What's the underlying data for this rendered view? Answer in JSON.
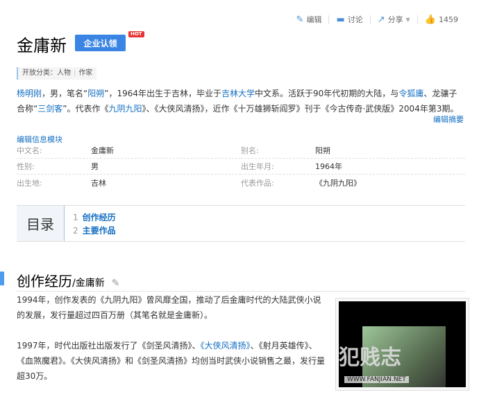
{
  "toolbar": {
    "edit": "编辑",
    "discuss": "讨论",
    "share": "分享",
    "likes": "1459"
  },
  "title": "金庸新",
  "claim_button": "企业认领",
  "hot_badge": "HOT",
  "category": {
    "label": "开放分类：",
    "items": [
      "人物",
      "作家"
    ]
  },
  "summary": {
    "parts": [
      {
        "t": "杨明刚",
        "link": true
      },
      {
        "t": "，男，笔名“"
      },
      {
        "t": "阳朔",
        "link": true
      },
      {
        "t": "”，1964年出生于吉林，毕业于"
      },
      {
        "t": "吉林大学",
        "link": true
      },
      {
        "t": "中文系。活跃于90年代初期的大陆，与"
      },
      {
        "t": "令狐庸",
        "link": true
      },
      {
        "t": "、龙骧子合称“"
      },
      {
        "t": "三剑客",
        "link": true
      },
      {
        "t": "”。代表作《"
      },
      {
        "t": "九阴九阳",
        "link": true
      },
      {
        "t": "》、《大侠风清扬》，近作《十万雄狮斩阎罗》刊于《今古传奇·武侠版》2004年第3期。"
      }
    ],
    "edit_summary": "编辑摘要"
  },
  "info": {
    "edit_label": "编辑信息模块",
    "rows": [
      [
        {
          "label": "中文名:",
          "value": "金庸新"
        },
        {
          "label": "别名:",
          "value": "阳朔"
        }
      ],
      [
        {
          "label": "性别:",
          "value": "男"
        },
        {
          "label": "出生年月:",
          "value": "1964年",
          "link": true
        }
      ],
      [
        {
          "label": "出生地:",
          "value": "吉林",
          "link": true
        },
        {
          "label": "代表作品:",
          "value": "《九阴九阳》",
          "link": true
        }
      ]
    ]
  },
  "catalog": {
    "title": "目录",
    "items": [
      {
        "n": "1",
        "label": "创作经历"
      },
      {
        "n": "2",
        "label": "主要作品"
      }
    ]
  },
  "section": {
    "title": "创作经历",
    "sub": "/金庸新",
    "p1": "1994年，创作发表的《九阴九阳》曾风靡全国，推动了后金庸时代的大陆武侠小说的发展，发行量超过四百万册（其笔名就是金庸新）。",
    "p2_parts": [
      {
        "t": "1997年，时代出版社出版发行了《剑圣风清扬》、"
      },
      {
        "t": "《大侠风清扬》",
        "link": true
      },
      {
        "t": "、《射月英雄传》、《血煞魔君》。《大侠风清扬》和《剑圣风清扬》均创当时武侠小说销售之最，发行量超30万。"
      }
    ]
  },
  "image": {
    "watermark": "犯贱志",
    "watermark_url": "WWW.FANJIAN.NET"
  }
}
